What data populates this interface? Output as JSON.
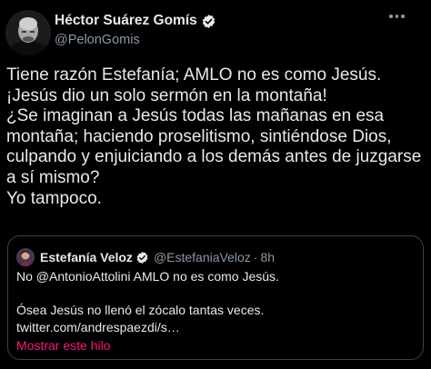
{
  "author": {
    "name": "Héctor Suárez Gomís",
    "handle": "@PelonGomis",
    "verified": true
  },
  "tweet": {
    "text": "Tiene razón Estefanía; AMLO no es como Jesús.\n¡Jesús dio un solo sermón en la montaña!\n¿Se imaginan a Jesús todas las mañanas en esa montaña; haciendo proselitismo, sintiéndose Dios, culpando y enjuiciando a los demás antes de juzgarse a sí mismo?\nYo tampoco."
  },
  "quoted": {
    "name": "Estefanía Veloz",
    "handle": "@EstefaniaVeloz",
    "separator": "·",
    "time": "8h",
    "verified": true,
    "text": "No @AntonioAttolini AMLO no es como Jesús.\n\nÓsea Jesús no llenó el zócalo tantas veces.\ntwitter.com/andrespaezdi/s…",
    "show_thread": "Mostrar este hilo"
  },
  "colors": {
    "background": "#000000",
    "text": "#e7e9ea",
    "secondary": "#8b98a5",
    "verified": "#1d9bf0",
    "link_accent": "#f91880",
    "border": "#38444d"
  },
  "icons": {
    "verified": "verified-badge-icon",
    "more": "more-options-icon"
  }
}
